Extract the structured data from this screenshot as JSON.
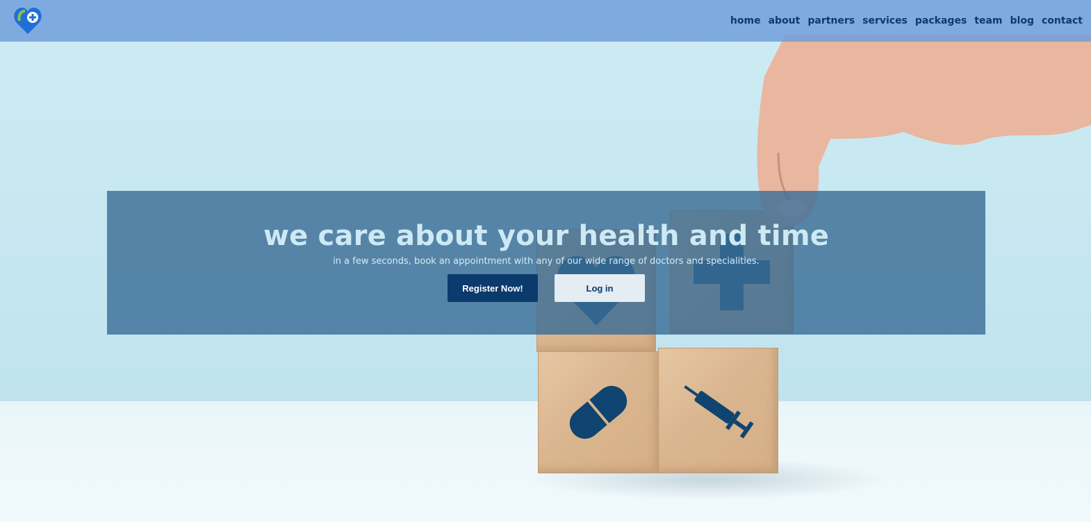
{
  "brand": {
    "logo_icon": "heart-plus-icon",
    "accent": "#0b3a6d"
  },
  "nav": {
    "items": [
      {
        "label": "home"
      },
      {
        "label": "about"
      },
      {
        "label": "partners"
      },
      {
        "label": "services"
      },
      {
        "label": "packages"
      },
      {
        "label": "team"
      },
      {
        "label": "blog"
      },
      {
        "label": "contact"
      }
    ]
  },
  "hero": {
    "title": "we care about your health and time",
    "subtitle": "in a few seconds, book an appointment with any of our wide range of doctors and specialities.",
    "register_label": "Register Now!",
    "login_label": "Log in"
  },
  "background": {
    "block_icons": [
      "heart-pulse-icon",
      "medical-cross-icon",
      "pill-icon",
      "syringe-icon"
    ]
  }
}
